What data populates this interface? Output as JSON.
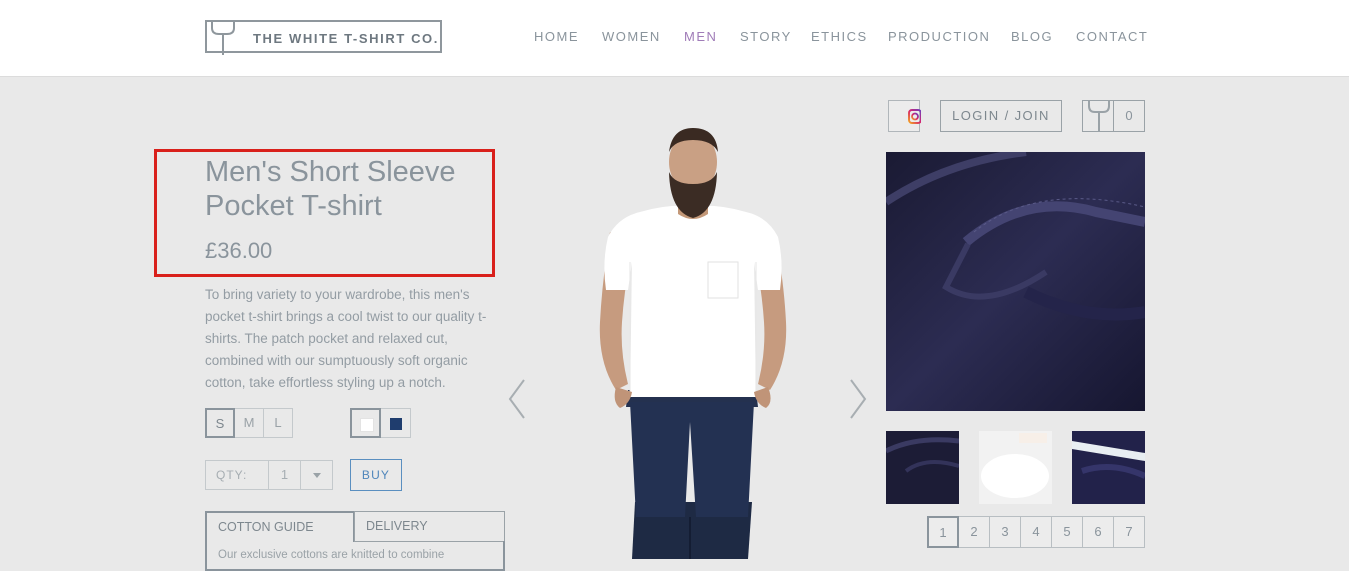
{
  "brand": {
    "name": "THE WHITE T-SHIRT CO."
  },
  "nav": {
    "items": [
      {
        "label": "HOME"
      },
      {
        "label": "WOMEN"
      },
      {
        "label": "MEN",
        "active": true
      },
      {
        "label": "STORY"
      },
      {
        "label": "ETHICS"
      },
      {
        "label": "PRODUCTION"
      },
      {
        "label": "BLOG"
      },
      {
        "label": "CONTACT"
      }
    ],
    "active_color": "#a07cb8"
  },
  "account": {
    "login_label": "LOGIN / JOIN",
    "cart_count": "0",
    "social_icon": "instagram-icon"
  },
  "product": {
    "title": "Men's Short Sleeve Pocket T-shirt",
    "price": "£36.00",
    "description": "To bring variety to your wardrobe, this men's pocket t-shirt brings a cool twist to our quality t-shirts. The patch pocket and relaxed cut, combined with our sumptuously soft organic cotton, take effortless styling up a notch.",
    "sizes": [
      "S",
      "M",
      "L"
    ],
    "selected_size": "S",
    "colors": [
      {
        "name": "white",
        "hex": "#ffffff",
        "selected": true
      },
      {
        "name": "navy",
        "hex": "#1f3d6e",
        "selected": false
      }
    ],
    "qty_label": "QTY:",
    "qty_value": "1",
    "buy_label": "BUY"
  },
  "tabs": {
    "items": [
      {
        "label": "COTTON GUIDE",
        "active": true
      },
      {
        "label": "DELIVERY",
        "active": false
      }
    ],
    "body_preview": "Our exclusive cottons are knitted to combine"
  },
  "gallery": {
    "pages": [
      "1",
      "2",
      "3",
      "4",
      "5",
      "6",
      "7"
    ],
    "active_page": "1"
  },
  "highlight_color": "#d9201b"
}
